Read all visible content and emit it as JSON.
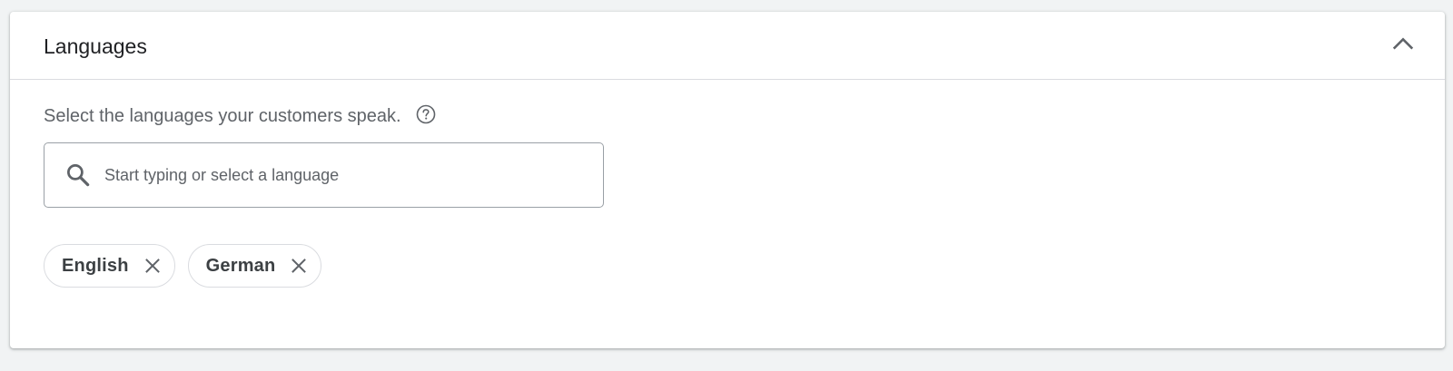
{
  "section": {
    "title": "Languages",
    "collapse_icon": "chevron-up-icon"
  },
  "body": {
    "description": "Select the languages your customers speak.",
    "help_icon": "help-circle-icon"
  },
  "search": {
    "icon": "search-icon",
    "placeholder": "Start typing or select a language",
    "value": ""
  },
  "selected_languages": [
    {
      "label": "English",
      "remove_icon": "close-icon"
    },
    {
      "label": "German",
      "remove_icon": "close-icon"
    }
  ],
  "colors": {
    "background": "#f1f3f4",
    "card": "#ffffff",
    "text_primary": "#202124",
    "text_secondary": "#5f6368",
    "border": "#dadce0"
  }
}
